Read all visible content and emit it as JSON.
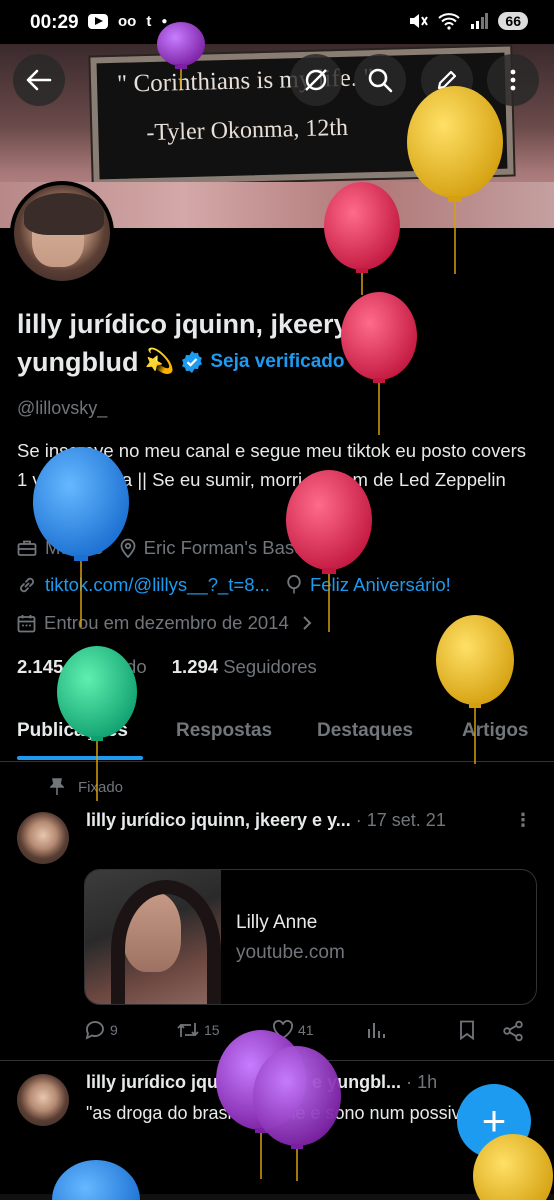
{
  "status_bar": {
    "time": "00:29",
    "left_icons": [
      "youtube-icon",
      "voicemail-icon",
      "tumblr-icon",
      "dot"
    ],
    "tumblr_glyph": "t",
    "voicemail_glyph": "oo",
    "battery": "66"
  },
  "header": {
    "back_icon": "back-arrow-icon",
    "buttons": [
      "grok-icon",
      "search-icon",
      "edit-icon",
      "more-vertical-icon"
    ]
  },
  "banner": {
    "line1": "\" Corinthians is my life. \"",
    "line2": "-Tyler Okonma, 12th"
  },
  "profile": {
    "name_line1": "lilly jurídico jquinn, jkeery e",
    "name_line2": "yungblud",
    "name_emoji": "💫",
    "verify_label": "Seja verificado",
    "handle": "@lillovsky_",
    "bio": "Se inscreve no meu canal e segue meu tiktok eu posto covers 1 vez por vida || Se eu sumir, morri ao som de Led Zeppelin",
    "occupation": "Músico",
    "location": "Eric Forman's Basement",
    "website": "tiktok.com/@lillys__?_t=8...",
    "birthday": "Feliz Aniversário!",
    "joined": "Entrou em dezembro de 2014",
    "following_count": "2.145",
    "following_label": "Seguindo",
    "followers_count": "1.294",
    "followers_label": "Seguidores"
  },
  "tabs": [
    {
      "label": "Publicações",
      "active": true
    },
    {
      "label": "Respostas",
      "active": false
    },
    {
      "label": "Destaques",
      "active": false
    },
    {
      "label": "Artigos",
      "active": false
    }
  ],
  "tweets": [
    {
      "pinned_label": "Fixado",
      "author": "lilly jurídico jquinn, jkeery e y...",
      "date": "17 set. 21",
      "card": {
        "title": "Lilly Anne",
        "domain": "youtube.com"
      },
      "replies": "9",
      "retweets": "15",
      "likes": "41"
    },
    {
      "author": "lilly jurídico jquinn, jkeery e yungbl...",
      "date": "1h",
      "text": "\"as droga do brasil da fome e sono num possivel\""
    }
  ],
  "fab_label": "+",
  "colors": {
    "accent": "#1d9bf0",
    "background": "#000000",
    "secondary_text": "#71767b"
  }
}
